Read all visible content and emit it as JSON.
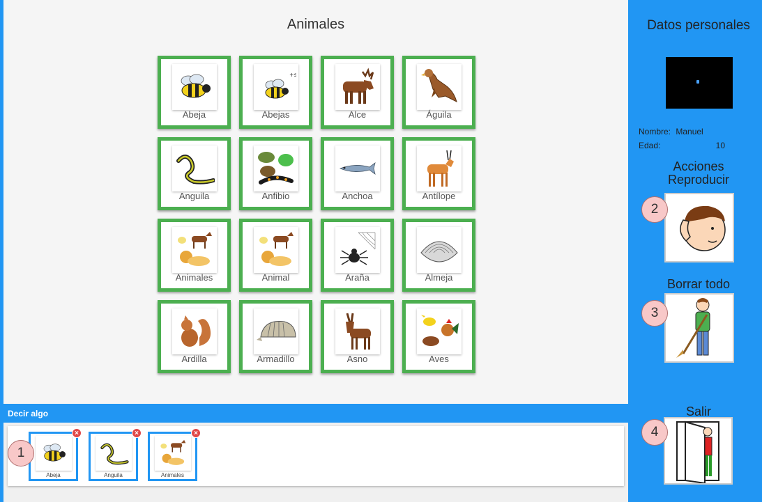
{
  "page": {
    "title": "Animales"
  },
  "grid": [
    {
      "label": "Abeja",
      "icon": "bee-icon"
    },
    {
      "label": "Abejas",
      "icon": "bees-icon"
    },
    {
      "label": "Alce",
      "icon": "moose-icon"
    },
    {
      "label": "Águila",
      "icon": "eagle-icon"
    },
    {
      "label": "Anguila",
      "icon": "eel-icon"
    },
    {
      "label": "Anfibio",
      "icon": "amphibian-icon"
    },
    {
      "label": "Anchoa",
      "icon": "anchovy-icon"
    },
    {
      "label": "Antílope",
      "icon": "antelope-icon"
    },
    {
      "label": "Animales",
      "icon": "animals-icon"
    },
    {
      "label": "Animal",
      "icon": "animal-icon"
    },
    {
      "label": "Araña",
      "icon": "spider-icon"
    },
    {
      "label": "Almeja",
      "icon": "clam-icon"
    },
    {
      "label": "Ardilla",
      "icon": "squirrel-icon"
    },
    {
      "label": "Armadillo",
      "icon": "armadillo-icon"
    },
    {
      "label": "Asno",
      "icon": "donkey-icon"
    },
    {
      "label": "Aves",
      "icon": "birds-icon"
    }
  ],
  "say": {
    "label": "Decir algo",
    "items": [
      {
        "label": "Abeja",
        "icon": "bee-icon"
      },
      {
        "label": "Anguila",
        "icon": "eel-icon"
      },
      {
        "label": "Animales",
        "icon": "animals-icon"
      }
    ],
    "remove_glyph": "×"
  },
  "sidebar": {
    "title": "Datos personales",
    "name_label": "Nombre:",
    "name_value": "Manuel",
    "age_label": "Edad:",
    "age_value": "10",
    "actions_title": "Acciones",
    "play_label": "Reproducir",
    "clear_label": "Borrar todo",
    "exit_label": "Salir"
  },
  "badges": [
    "1",
    "2",
    "3",
    "4"
  ],
  "colors": {
    "accent": "#2196f3",
    "card_border": "#4caf50",
    "badge_fill": "#f8c8c8",
    "remove": "#e04848"
  }
}
